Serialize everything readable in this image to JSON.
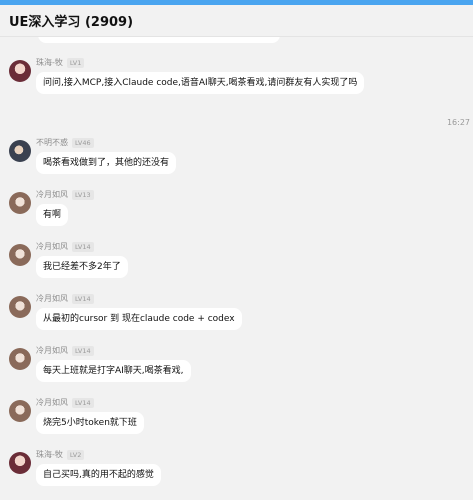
{
  "header": {
    "title": "UE深入学习 (2909)"
  },
  "time_separator": "16:27",
  "messages": [
    {
      "sender": "珠海-牧",
      "level": "LV1",
      "text": "问问,接入MCP,接入Claude code,语音AI聊天,喝茶看戏,请问群友有人实现了吗"
    },
    {
      "sender": "不明不惑",
      "level": "LV46",
      "text": "喝茶看戏做到了，其他的还没有"
    },
    {
      "sender": "冷月如风",
      "level": "LV13",
      "text": "有啊"
    },
    {
      "sender": "冷月如风",
      "level": "LV14",
      "text": "我已经差不多2年了"
    },
    {
      "sender": "冷月如风",
      "level": "LV14",
      "text": "从最初的cursor  到 现在claude code + codex"
    },
    {
      "sender": "冷月如风",
      "level": "LV14",
      "text": "每天上班就是打字AI聊天,喝茶看戏,"
    },
    {
      "sender": "冷月如风",
      "level": "LV14",
      "text": "烧完5小时token就下班"
    },
    {
      "sender": "珠海-牧",
      "level": "LV2",
      "text": "自己买吗,真的用不起的感觉"
    }
  ]
}
